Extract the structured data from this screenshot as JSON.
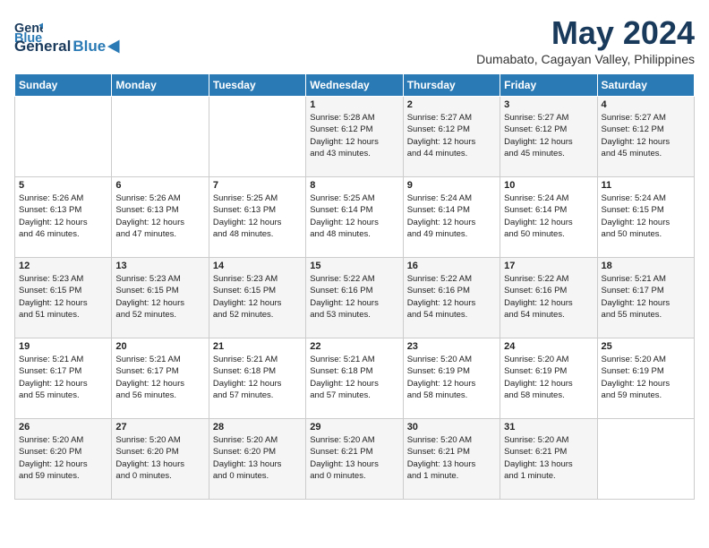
{
  "logo": {
    "line1": "General",
    "line2": "Blue"
  },
  "title": "May 2024",
  "subtitle": "Dumabato, Cagayan Valley, Philippines",
  "days_of_week": [
    "Sunday",
    "Monday",
    "Tuesday",
    "Wednesday",
    "Thursday",
    "Friday",
    "Saturday"
  ],
  "weeks": [
    [
      {
        "day": "",
        "info": ""
      },
      {
        "day": "",
        "info": ""
      },
      {
        "day": "",
        "info": ""
      },
      {
        "day": "1",
        "info": "Sunrise: 5:28 AM\nSunset: 6:12 PM\nDaylight: 12 hours\nand 43 minutes."
      },
      {
        "day": "2",
        "info": "Sunrise: 5:27 AM\nSunset: 6:12 PM\nDaylight: 12 hours\nand 44 minutes."
      },
      {
        "day": "3",
        "info": "Sunrise: 5:27 AM\nSunset: 6:12 PM\nDaylight: 12 hours\nand 45 minutes."
      },
      {
        "day": "4",
        "info": "Sunrise: 5:27 AM\nSunset: 6:12 PM\nDaylight: 12 hours\nand 45 minutes."
      }
    ],
    [
      {
        "day": "5",
        "info": "Sunrise: 5:26 AM\nSunset: 6:13 PM\nDaylight: 12 hours\nand 46 minutes."
      },
      {
        "day": "6",
        "info": "Sunrise: 5:26 AM\nSunset: 6:13 PM\nDaylight: 12 hours\nand 47 minutes."
      },
      {
        "day": "7",
        "info": "Sunrise: 5:25 AM\nSunset: 6:13 PM\nDaylight: 12 hours\nand 48 minutes."
      },
      {
        "day": "8",
        "info": "Sunrise: 5:25 AM\nSunset: 6:14 PM\nDaylight: 12 hours\nand 48 minutes."
      },
      {
        "day": "9",
        "info": "Sunrise: 5:24 AM\nSunset: 6:14 PM\nDaylight: 12 hours\nand 49 minutes."
      },
      {
        "day": "10",
        "info": "Sunrise: 5:24 AM\nSunset: 6:14 PM\nDaylight: 12 hours\nand 50 minutes."
      },
      {
        "day": "11",
        "info": "Sunrise: 5:24 AM\nSunset: 6:15 PM\nDaylight: 12 hours\nand 50 minutes."
      }
    ],
    [
      {
        "day": "12",
        "info": "Sunrise: 5:23 AM\nSunset: 6:15 PM\nDaylight: 12 hours\nand 51 minutes."
      },
      {
        "day": "13",
        "info": "Sunrise: 5:23 AM\nSunset: 6:15 PM\nDaylight: 12 hours\nand 52 minutes."
      },
      {
        "day": "14",
        "info": "Sunrise: 5:23 AM\nSunset: 6:15 PM\nDaylight: 12 hours\nand 52 minutes."
      },
      {
        "day": "15",
        "info": "Sunrise: 5:22 AM\nSunset: 6:16 PM\nDaylight: 12 hours\nand 53 minutes."
      },
      {
        "day": "16",
        "info": "Sunrise: 5:22 AM\nSunset: 6:16 PM\nDaylight: 12 hours\nand 54 minutes."
      },
      {
        "day": "17",
        "info": "Sunrise: 5:22 AM\nSunset: 6:16 PM\nDaylight: 12 hours\nand 54 minutes."
      },
      {
        "day": "18",
        "info": "Sunrise: 5:21 AM\nSunset: 6:17 PM\nDaylight: 12 hours\nand 55 minutes."
      }
    ],
    [
      {
        "day": "19",
        "info": "Sunrise: 5:21 AM\nSunset: 6:17 PM\nDaylight: 12 hours\nand 55 minutes."
      },
      {
        "day": "20",
        "info": "Sunrise: 5:21 AM\nSunset: 6:17 PM\nDaylight: 12 hours\nand 56 minutes."
      },
      {
        "day": "21",
        "info": "Sunrise: 5:21 AM\nSunset: 6:18 PM\nDaylight: 12 hours\nand 57 minutes."
      },
      {
        "day": "22",
        "info": "Sunrise: 5:21 AM\nSunset: 6:18 PM\nDaylight: 12 hours\nand 57 minutes."
      },
      {
        "day": "23",
        "info": "Sunrise: 5:20 AM\nSunset: 6:19 PM\nDaylight: 12 hours\nand 58 minutes."
      },
      {
        "day": "24",
        "info": "Sunrise: 5:20 AM\nSunset: 6:19 PM\nDaylight: 12 hours\nand 58 minutes."
      },
      {
        "day": "25",
        "info": "Sunrise: 5:20 AM\nSunset: 6:19 PM\nDaylight: 12 hours\nand 59 minutes."
      }
    ],
    [
      {
        "day": "26",
        "info": "Sunrise: 5:20 AM\nSunset: 6:20 PM\nDaylight: 12 hours\nand 59 minutes."
      },
      {
        "day": "27",
        "info": "Sunrise: 5:20 AM\nSunset: 6:20 PM\nDaylight: 13 hours\nand 0 minutes."
      },
      {
        "day": "28",
        "info": "Sunrise: 5:20 AM\nSunset: 6:20 PM\nDaylight: 13 hours\nand 0 minutes."
      },
      {
        "day": "29",
        "info": "Sunrise: 5:20 AM\nSunset: 6:21 PM\nDaylight: 13 hours\nand 0 minutes."
      },
      {
        "day": "30",
        "info": "Sunrise: 5:20 AM\nSunset: 6:21 PM\nDaylight: 13 hours\nand 1 minute."
      },
      {
        "day": "31",
        "info": "Sunrise: 5:20 AM\nSunset: 6:21 PM\nDaylight: 13 hours\nand 1 minute."
      },
      {
        "day": "",
        "info": ""
      }
    ]
  ]
}
